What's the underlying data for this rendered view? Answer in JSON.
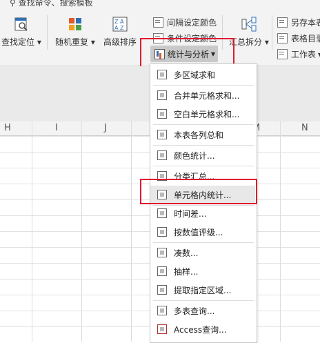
{
  "ribbon": {
    "search_hint": "查找命令、搜索模板",
    "find_locate": "查找定位",
    "random_repeat": "随机重复",
    "advanced_sort": "高级排序",
    "interval_color": "间隔设定颜色",
    "condition_color": "条件设定颜色",
    "stats_analysis": "统计与分析",
    "summary_split": "汇总拆分",
    "save_as_table": "另存本表",
    "table_dir": "表格目录",
    "worksheet": "工作表"
  },
  "columns": [
    "H",
    "I",
    "J",
    "M",
    "N"
  ],
  "menu": {
    "items": [
      {
        "label": "多区域求和"
      },
      {
        "label": "合并单元格求和..."
      },
      {
        "label": "空白单元格求和..."
      },
      {
        "label": "本表各列总和"
      },
      {
        "label": "颜色统计..."
      },
      {
        "label": "分类汇总..."
      },
      {
        "label": "单元格内统计..."
      },
      {
        "label": "时间差..."
      },
      {
        "label": "按数值评级..."
      },
      {
        "label": "凑数..."
      },
      {
        "label": "抽样..."
      },
      {
        "label": "提取指定区域..."
      },
      {
        "label": "多表查询..."
      },
      {
        "label": "Access查询..."
      }
    ]
  },
  "colors": {
    "highlight_border": "#e0182e"
  }
}
